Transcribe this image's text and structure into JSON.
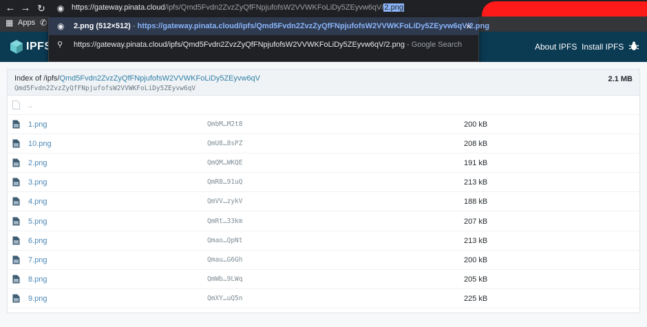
{
  "browser": {
    "url_host": "https://gateway.pinata.cloud",
    "url_path": "/ipfs/Qmd5Fvdn2ZvzZyQfFNpjufofsW2VVWKFoLiDy5ZEyvw6qV/",
    "url_selected": "2.png",
    "back_icon": "back-arrow-icon",
    "forward_icon": "forward-arrow-icon",
    "reload_icon": "reload-icon",
    "site_info_icon": "globe-icon"
  },
  "bookmarks": {
    "apps_label": "Apps"
  },
  "omnibox": {
    "row1_title": "2.png (512×512)",
    "row1_sep": " - ",
    "row1_url": "https://gateway.pinata.cloud/ipfs/Qmd5Fvdn2ZvzZyQfFNpjufofsW2VVWKFoLiDy5ZEyvw6qV/2.png",
    "row1_close": "×",
    "row2_query": "https://gateway.pinata.cloud/ipfs/Qmd5Fvdn2ZvzZyQfFNpjufofsW2VVWKFoLiDy5ZEyvw6qV/2.png",
    "row2_suffix": " - Google Search"
  },
  "header": {
    "brand": "IPFS",
    "about_label": "About IPFS",
    "install_label": "Install IPFS",
    "accent": "#0b3a53"
  },
  "listing": {
    "title_prefix": "Index of /ipfs/",
    "title_hash": "Qmd5Fvdn2ZvzZyQfFNpjufofsW2VVWKFoLiDy5ZEyvw6qV",
    "subtitle": "Qmd5Fvdn2ZvzZyQfFNpjufofsW2VVWKFoLiDy5ZEyvw6qV",
    "total_size": "2.1 MB",
    "parent_label": "..",
    "rows": [
      {
        "name": "1.png",
        "cid": "QmbM…M2t8",
        "size": "200 kB"
      },
      {
        "name": "10.png",
        "cid": "QmU8…8sPZ",
        "size": "208 kB"
      },
      {
        "name": "2.png",
        "cid": "QmQM…WKQE",
        "size": "191 kB"
      },
      {
        "name": "3.png",
        "cid": "QmR8…91uQ",
        "size": "213 kB"
      },
      {
        "name": "4.png",
        "cid": "QmVV…zykV",
        "size": "188 kB"
      },
      {
        "name": "5.png",
        "cid": "QmRt…33km",
        "size": "207 kB"
      },
      {
        "name": "6.png",
        "cid": "Qmao…QpNt",
        "size": "213 kB"
      },
      {
        "name": "7.png",
        "cid": "Qmau…G6Gh",
        "size": "200 kB"
      },
      {
        "name": "8.png",
        "cid": "QmWb…9LWq",
        "size": "205 kB"
      },
      {
        "name": "9.png",
        "cid": "QmXY…uQ5n",
        "size": "225 kB"
      }
    ]
  }
}
